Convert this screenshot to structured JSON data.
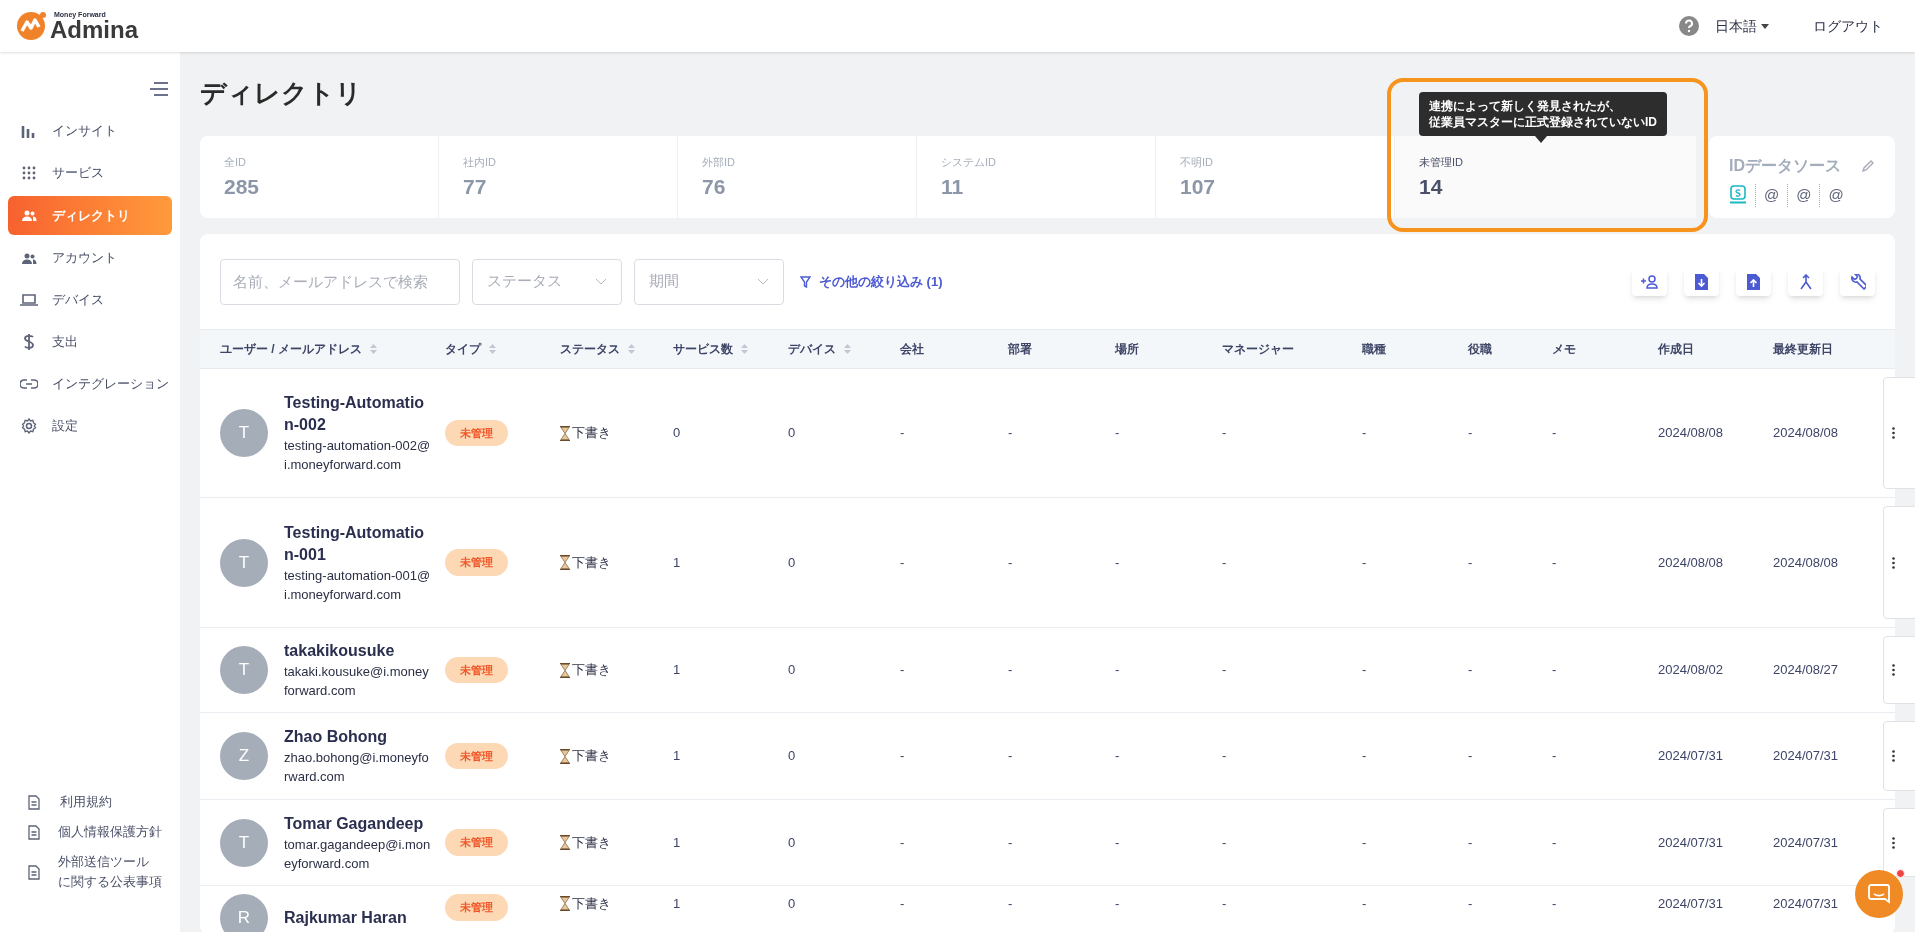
{
  "header": {
    "brand_small": "Money Forward",
    "brand": "Admina",
    "language": "日本語",
    "logout": "ログアウト"
  },
  "sidebar": {
    "items": [
      {
        "label": "インサイト",
        "selected": false
      },
      {
        "label": "サービス",
        "selected": false
      },
      {
        "label": "ディレクトリ",
        "selected": true
      },
      {
        "label": "アカウント",
        "selected": false
      },
      {
        "label": "デバイス",
        "selected": false
      },
      {
        "label": "支出",
        "selected": false
      },
      {
        "label": "インテグレーション",
        "selected": false
      },
      {
        "label": "設定",
        "selected": false
      }
    ],
    "footer_items": [
      {
        "lines": [
          "利用規約"
        ]
      },
      {
        "lines": [
          "個人情報保護方針"
        ]
      },
      {
        "lines": [
          "外部送信ツール",
          "に関する公表事項"
        ]
      }
    ]
  },
  "page_title": "ディレクトリ",
  "stats": [
    {
      "label": "全ID",
      "value": "285",
      "selected": false
    },
    {
      "label": "社内ID",
      "value": "77",
      "selected": false
    },
    {
      "label": "外部ID",
      "value": "76",
      "selected": false
    },
    {
      "label": "システムID",
      "value": "11",
      "selected": false
    },
    {
      "label": "不明ID",
      "value": "107",
      "selected": false
    },
    {
      "label": "未管理ID",
      "value": "14",
      "selected": true,
      "tooltip_lines": [
        "連携によって新しく発見されたが、",
        "従業員マスターに正式登録されていないID"
      ]
    }
  ],
  "id_source": {
    "title": "IDデータソース",
    "sources": [
      "@",
      "@",
      "@"
    ]
  },
  "filters": {
    "search_placeholder": "名前、メールアドレスで検索",
    "status_placeholder": "ステータス",
    "period_placeholder": "期間",
    "more_filters": "その他の絞り込み (1)"
  },
  "table": {
    "columns": [
      {
        "label": "ユーザー / メールアドレス",
        "sortable": true
      },
      {
        "label": "タイプ",
        "sortable": true
      },
      {
        "label": "ステータス",
        "sortable": true
      },
      {
        "label": "サービス数",
        "sortable": true
      },
      {
        "label": "デバイス",
        "sortable": true
      },
      {
        "label": "会社",
        "sortable": false
      },
      {
        "label": "部署",
        "sortable": false
      },
      {
        "label": "場所",
        "sortable": false
      },
      {
        "label": "マネージャー",
        "sortable": false
      },
      {
        "label": "職種",
        "sortable": false
      },
      {
        "label": "役職",
        "sortable": false
      },
      {
        "label": "メモ",
        "sortable": false
      },
      {
        "label": "作成日",
        "sortable": false
      },
      {
        "label": "最終更新日",
        "sortable": false
      }
    ],
    "rows": [
      {
        "avatar": "T",
        "name": "Testing-Automation-002",
        "email": "testing-automation-002@i.moneyforward.com",
        "type": "未管理",
        "status": "下書き",
        "services": "0",
        "devices": "0",
        "company": "-",
        "department": "-",
        "location": "-",
        "manager": "-",
        "job": "-",
        "role": "-",
        "memo": "-",
        "created": "2024/08/08",
        "updated": "2024/08/08"
      },
      {
        "avatar": "T",
        "name": "Testing-Automation-001",
        "email": "testing-automation-001@i.moneyforward.com",
        "type": "未管理",
        "status": "下書き",
        "services": "1",
        "devices": "0",
        "company": "-",
        "department": "-",
        "location": "-",
        "manager": "-",
        "job": "-",
        "role": "-",
        "memo": "-",
        "created": "2024/08/08",
        "updated": "2024/08/08"
      },
      {
        "avatar": "T",
        "name": "takakikousuke",
        "email": "takaki.kousuke@i.moneyforward.com",
        "type": "未管理",
        "status": "下書き",
        "services": "1",
        "devices": "0",
        "company": "-",
        "department": "-",
        "location": "-",
        "manager": "-",
        "job": "-",
        "role": "-",
        "memo": "-",
        "created": "2024/08/02",
        "updated": "2024/08/27"
      },
      {
        "avatar": "Z",
        "name": "Zhao Bohong",
        "email": "zhao.bohong@i.moneyforward.com",
        "type": "未管理",
        "status": "下書き",
        "services": "1",
        "devices": "0",
        "company": "-",
        "department": "-",
        "location": "-",
        "manager": "-",
        "job": "-",
        "role": "-",
        "memo": "-",
        "created": "2024/07/31",
        "updated": "2024/07/31"
      },
      {
        "avatar": "T",
        "name": "Tomar Gagandeep",
        "email": "tomar.gagandeep@i.moneyforward.com",
        "type": "未管理",
        "status": "下書き",
        "services": "1",
        "devices": "0",
        "company": "-",
        "department": "-",
        "location": "-",
        "manager": "-",
        "job": "-",
        "role": "-",
        "memo": "-",
        "created": "2024/07/31",
        "updated": "2024/07/31"
      },
      {
        "avatar": "R",
        "name": "Rajkumar Haran",
        "type": "未管理",
        "status": "下書き",
        "services": "1",
        "devices": "0",
        "company": "-",
        "department": "-",
        "location": "-",
        "manager": "-",
        "job": "-",
        "role": "-",
        "memo": "-",
        "created": "2024/07/31",
        "updated": "2024/07/31"
      }
    ]
  }
}
